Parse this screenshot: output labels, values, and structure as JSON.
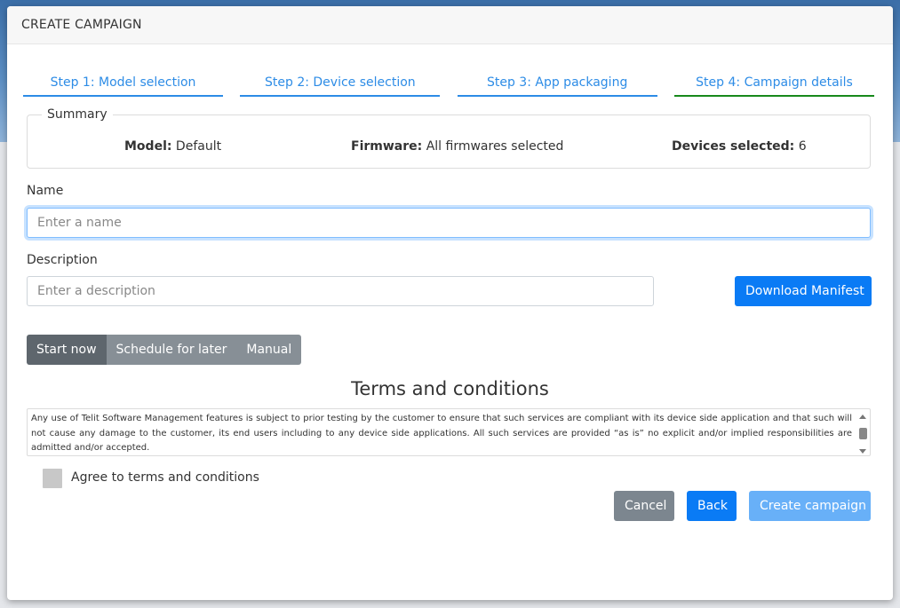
{
  "modal": {
    "title": "CREATE CAMPAIGN"
  },
  "steps": [
    {
      "label": "Step 1: Model selection"
    },
    {
      "label": "Step 2: Device selection"
    },
    {
      "label": "Step 3: App packaging"
    },
    {
      "label": "Step 4: Campaign details"
    }
  ],
  "summary": {
    "legend": "Summary",
    "model_label": "Model:",
    "model_value": "Default",
    "firmware_label": "Firmware:",
    "firmware_value": "All firmwares selected",
    "devices_label": "Devices selected:",
    "devices_value": "6"
  },
  "form": {
    "name_label": "Name",
    "name_placeholder": "Enter a name",
    "description_label": "Description",
    "description_placeholder": "Enter a description",
    "download_manifest_label": "Download Manifest"
  },
  "schedule": {
    "start_now": "Start now",
    "schedule_later": "Schedule for later",
    "manual": "Manual"
  },
  "terms": {
    "title": "Terms and conditions",
    "text": "Any use of Telit Software Management features is subject to prior testing by the customer to ensure that such services are compliant with its device side application and that such will not cause any damage to the customer, its end users including to any device side applications. All such services are provided “as is” no explicit and/or implied responsibilities are admitted and/or accepted.",
    "agree_label": "Agree to terms and conditions"
  },
  "actions": {
    "cancel": "Cancel",
    "back": "Back",
    "create": "Create campaign"
  },
  "colors": {
    "primary": "#0a7bf5",
    "step_link": "#2d8ce6",
    "step_active_underline": "#17891b",
    "secondary": "#7c868f"
  }
}
